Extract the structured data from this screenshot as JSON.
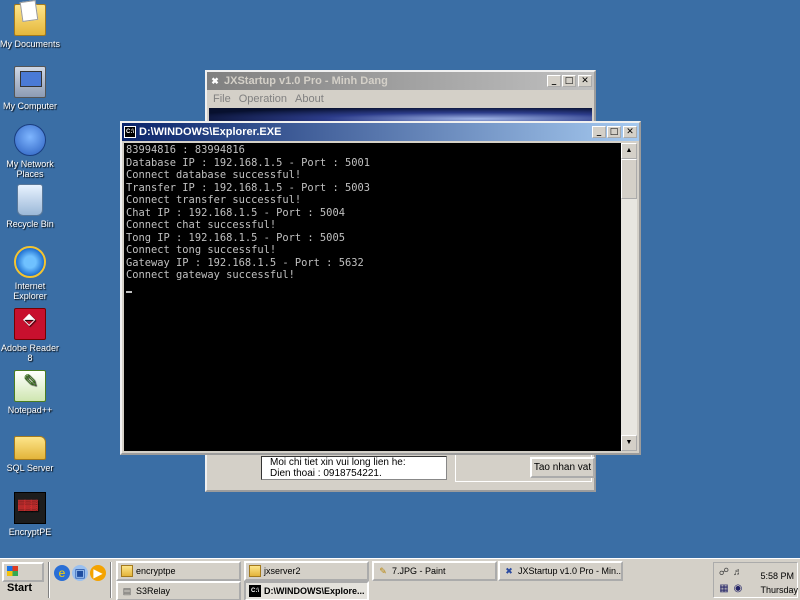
{
  "desktop": {
    "icons": [
      {
        "label": "My Documents"
      },
      {
        "label": "My Computer"
      },
      {
        "label": "My Network Places"
      },
      {
        "label": "Recycle Bin"
      },
      {
        "label": "Internet Explorer"
      },
      {
        "label": "Adobe Reader 8"
      },
      {
        "label": "Notepad++"
      },
      {
        "label": "SQL Server"
      },
      {
        "label": "EncryptPE"
      }
    ]
  },
  "jx_window": {
    "title": "JXStartup v1.0 Pro - Minh Dang",
    "menu": [
      "File",
      "Operation",
      "About"
    ],
    "info_line1": "Moi chi tiet xin vui long lien he:",
    "info_line2": "Dien thoai : 0918754221.",
    "create_button": "Tao nhan vat"
  },
  "console_window": {
    "title": "D:\\WINDOWS\\Explorer.EXE",
    "lines": [
      "83994816 : 83994816",
      "Database IP : 192.168.1.5 - Port : 5001",
      "Connect database successful!",
      "Transfer IP : 192.168.1.5 - Port : 5003",
      "Connect transfer successful!",
      "Chat IP : 192.168.1.5 - Port : 5004",
      "Connect chat successful!",
      "Tong IP : 192.168.1.5 - Port : 5005",
      "Connect tong successful!",
      "Gateway IP : 192.168.1.5 - Port : 5632",
      "Connect gateway successful!"
    ]
  },
  "taskbar": {
    "start_label": "Start",
    "tasks_row1": [
      "encryptpe",
      "jxserver2",
      "7.JPG - Paint",
      "JXStartup v1.0 Pro - Min..."
    ],
    "tasks_row2": [
      "S3Relay",
      "D:\\WINDOWS\\Explore..."
    ],
    "clock": "5:58 PM",
    "day": "Thursday"
  }
}
